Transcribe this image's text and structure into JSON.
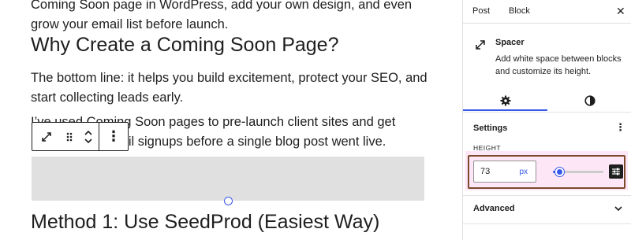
{
  "editor": {
    "intro_text": "Coming Soon page in WordPress, add your own design, and even grow your email list before launch.",
    "heading_1": "Why Create a Coming Soon Page?",
    "paragraph_1": "The bottom line: it helps you build excitement, protect your SEO, and start collecting leads early.",
    "paragraph_2": "I’ve used Coming Soon pages to pre-launch client sites and get hundreds of email signups before a single blog post went live.",
    "heading_2": "Method 1: Use SeedProd (Easiest Way)"
  },
  "block_toolbar": {
    "transform_icon": "expand-arrows-icon",
    "drag_icon": "drag-handle-icon",
    "move_up_icon": "chevron-up-icon",
    "move_down_icon": "chevron-down-icon",
    "more_label": "⋮"
  },
  "sidebar": {
    "tabs": [
      {
        "label": "Post"
      },
      {
        "label": "Block",
        "active": true
      }
    ],
    "close_label": "✕",
    "block_card": {
      "icon": "resize-arrows-icon",
      "title": "Spacer",
      "description": "Add white space between blocks and customize its height."
    },
    "inspector_tabs": [
      {
        "name": "settings",
        "icon": "gear-icon",
        "active": true
      },
      {
        "name": "styles",
        "icon": "half-circle-icon",
        "active": false
      }
    ],
    "settings": {
      "title": "Settings",
      "menu_label": "⋮",
      "height_label": "HEIGHT",
      "height_value": "73",
      "height_unit": "px",
      "slider_fraction": 0.12,
      "unit_toggle_icon": "sliders-icon"
    },
    "advanced": {
      "label": "Advanced",
      "icon": "chevron-down-icon"
    }
  },
  "colors": {
    "accent": "#3858e9",
    "spacer_bg": "#e0e0e0",
    "highlight": "#fde7f6",
    "annotation_frame": "#7a4a2a"
  }
}
